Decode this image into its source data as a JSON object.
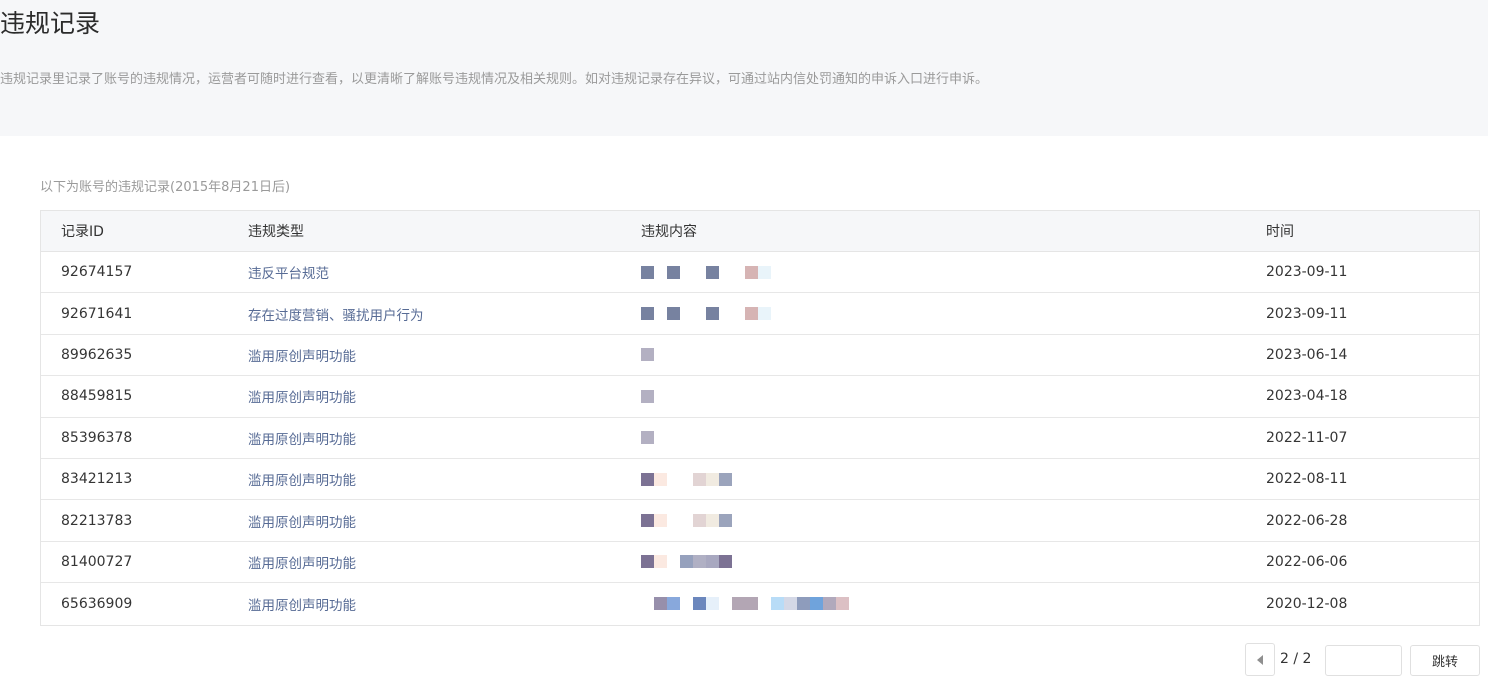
{
  "header": {
    "title": "违规记录",
    "description": "违规记录里记录了账号的违规情况，运营者可随时进行查看，以更清晰了解账号违规情况及相关规则。如对违规记录存在异议，可通过站内信处罚通知的申诉入口进行申诉。"
  },
  "caption": "以下为账号的违规记录(2015年8月21日后)",
  "table": {
    "columns": [
      "记录ID",
      "违规类型",
      "违规内容",
      "时间"
    ],
    "rows": [
      {
        "id": "92674157",
        "type": "违反平台规范",
        "time": "2023-09-11",
        "mosaic": [
          "#7782a0",
          "#ffffff",
          "#7782a0",
          "#ffffff",
          "#ffffff",
          "#7782a0",
          "#ffffff",
          "#ffffff",
          "#d6b4b4",
          "#e9f4fa"
        ]
      },
      {
        "id": "92671641",
        "type": "存在过度营销、骚扰用户行为",
        "time": "2023-09-11",
        "mosaic": [
          "#7782a0",
          "#ffffff",
          "#7782a0",
          "#ffffff",
          "#ffffff",
          "#7782a0",
          "#ffffff",
          "#ffffff",
          "#d6b4b4",
          "#e9f4fa"
        ]
      },
      {
        "id": "89962635",
        "type": "滥用原创声明功能",
        "time": "2023-06-14",
        "mosaic": [
          "#b3b0c2"
        ]
      },
      {
        "id": "88459815",
        "type": "滥用原创声明功能",
        "time": "2023-04-18",
        "mosaic": [
          "#b3b0c2"
        ]
      },
      {
        "id": "85396378",
        "type": "滥用原创声明功能",
        "time": "2022-11-07",
        "mosaic": [
          "#b3b0c2"
        ]
      },
      {
        "id": "83421213",
        "type": "滥用原创声明功能",
        "time": "2022-08-11",
        "mosaic": [
          "#7c7294",
          "#fbe9e1",
          "#ffffff",
          "#ffffff",
          "#e2d4d4",
          "#f1ebe1",
          "#9ba4bc"
        ]
      },
      {
        "id": "82213783",
        "type": "滥用原创声明功能",
        "time": "2022-06-28",
        "mosaic": [
          "#7c7294",
          "#fbe9e1",
          "#ffffff",
          "#ffffff",
          "#e2d4d4",
          "#f1ebe1",
          "#9ba4bc"
        ]
      },
      {
        "id": "81400727",
        "type": "滥用原创声明功能",
        "time": "2022-06-06",
        "mosaic": [
          "#7c7294",
          "#fbe9e1",
          "#ffffff",
          "#96a1bd",
          "#b0b0c4",
          "#a8a8c0",
          "#7c7294"
        ]
      },
      {
        "id": "65636909",
        "type": "滥用原创声明功能",
        "time": "2020-12-08",
        "mosaic": [
          "#ffffff",
          "#978fab",
          "#88a8dc",
          "#ffffff",
          "#6b87bd",
          "#e6f0fa",
          "#ffffff",
          "#b3a6b4",
          "#b3a6b4",
          "#ffffff",
          "#b8dcf7",
          "#d4d8e6",
          "#8e9cbc",
          "#6fa3dc",
          "#b1a9bc",
          "#dcc0c4"
        ]
      }
    ]
  },
  "pagination": {
    "prev_icon": "chevron-left-icon",
    "page_display": "2 / 2",
    "jump_input_value": "",
    "jump_label": "跳转"
  }
}
